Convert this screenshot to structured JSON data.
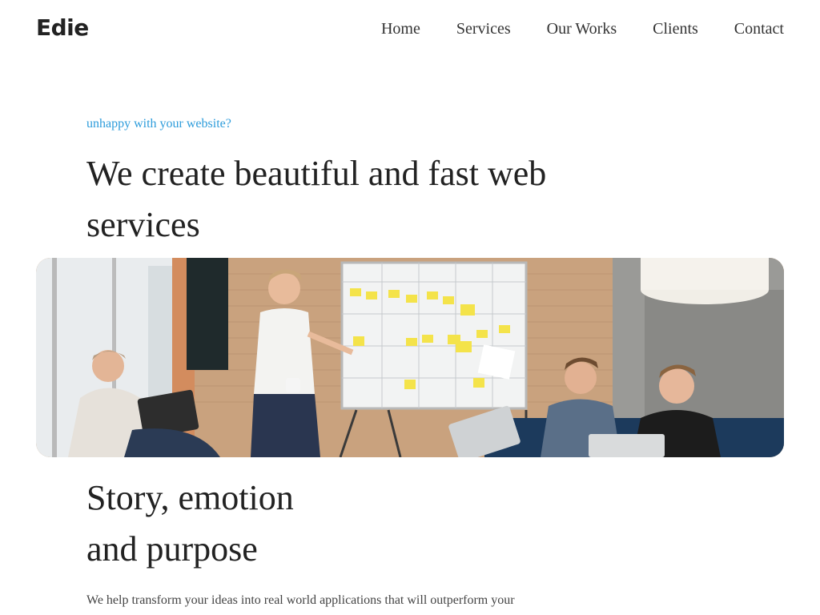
{
  "brand": {
    "name": "Edie"
  },
  "nav": {
    "items": [
      {
        "label": "Home"
      },
      {
        "label": "Services"
      },
      {
        "label": "Our Works"
      },
      {
        "label": "Clients"
      },
      {
        "label": "Contact"
      }
    ]
  },
  "hero": {
    "tagline": "unhappy with your website?",
    "title_line1": "We create beautiful and fast web",
    "title_line2": "services"
  },
  "story": {
    "title_line1": "Story, emotion",
    "title_line2": "and purpose",
    "body": "We help transform your ideas into real world applications that will outperform your"
  },
  "colors": {
    "accent": "#2d9cdb",
    "text": "#333333",
    "background": "#ffffff"
  }
}
